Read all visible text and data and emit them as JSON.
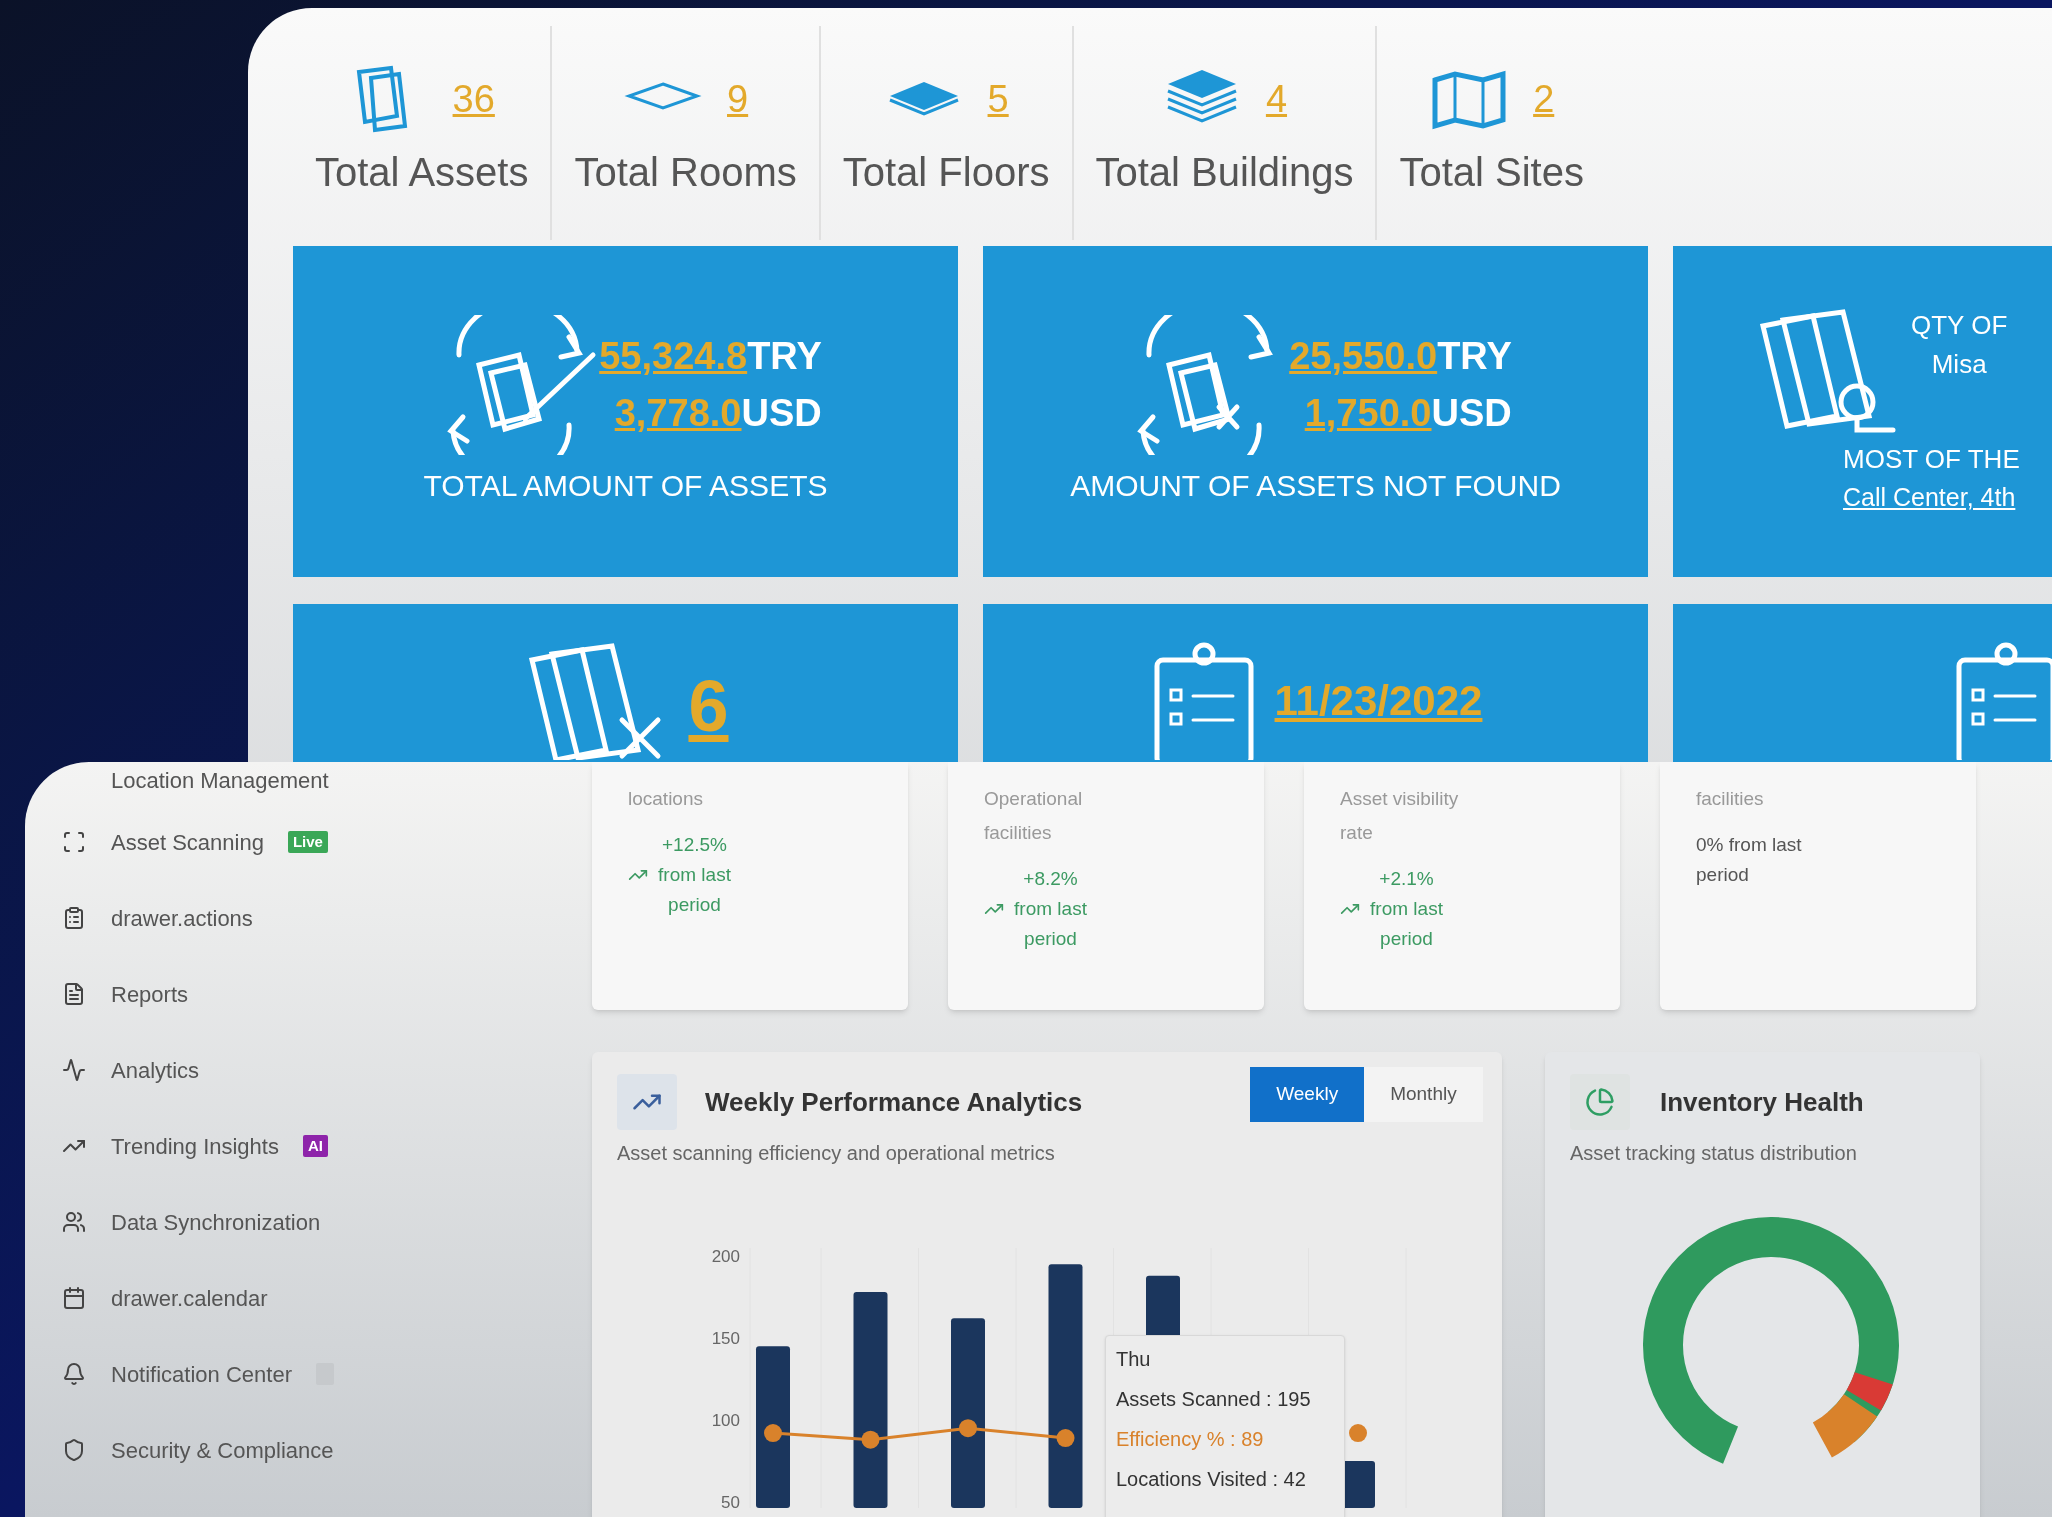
{
  "back_window": {
    "stats": [
      {
        "kind": "assets",
        "value": "36",
        "label": "Total Assets"
      },
      {
        "kind": "rooms",
        "value": "9",
        "label": "Total Rooms"
      },
      {
        "kind": "floors",
        "value": "5",
        "label": "Total Floors"
      },
      {
        "kind": "buildings",
        "value": "4",
        "label": "Total Buildings"
      },
      {
        "kind": "sites",
        "value": "2",
        "label": "Total Sites"
      }
    ],
    "tiles": [
      {
        "kind": "found",
        "amounts": [
          {
            "value": "55,324.8",
            "unit": "TRY"
          },
          {
            "value": "3,778.0",
            "unit": "USD"
          }
        ],
        "caption": "TOTAL AMOUNT OF ASSETS"
      },
      {
        "kind": "not_found",
        "amounts": [
          {
            "value": "25,550.0",
            "unit": "TRY"
          },
          {
            "value": "1,750.0",
            "unit": "USD"
          }
        ],
        "caption": "AMOUNT OF ASSETS NOT FOUND"
      },
      {
        "kind": "misplaced",
        "lines": [
          "QTY OF",
          "Misa"
        ],
        "caption": "MOST OF THE",
        "link": "Call Center, 4th"
      }
    ],
    "tiles_row2": [
      {
        "kind": "missing",
        "value": "6"
      },
      {
        "kind": "clipboard",
        "value": "11/23/2022"
      },
      {
        "kind": "clipboard"
      }
    ]
  },
  "front_window": {
    "sidebar": {
      "items": [
        {
          "label": "Location Management"
        },
        {
          "kind": "scan",
          "label": "Asset Scanning",
          "badge": {
            "text": "Live",
            "color": "#3aa757"
          }
        },
        {
          "kind": "clipboard",
          "label": "drawer.actions"
        },
        {
          "kind": "report",
          "label": "Reports"
        },
        {
          "kind": "activity",
          "label": "Analytics"
        },
        {
          "kind": "trend",
          "label": "Trending Insights",
          "badge": {
            "text": "AI",
            "color": "#8e24aa"
          }
        },
        {
          "kind": "users",
          "label": "Data Synchronization"
        },
        {
          "kind": "calendar",
          "label": "drawer.calendar"
        },
        {
          "kind": "bell",
          "label": "Notification Center",
          "badge": {
            "color": "#c6c9cc"
          }
        },
        {
          "kind": "shield",
          "label": "Security & Compliance"
        }
      ]
    },
    "stat_cards": [
      {
        "description": "locations",
        "change": "+12.5%",
        "note": "from last period",
        "kind": "up"
      },
      {
        "description": "Operational facilities",
        "change": "+8.2%",
        "note": "from last period",
        "kind": "up"
      },
      {
        "description": "Asset visibility rate",
        "change": "+2.1%",
        "note": "from last period",
        "kind": "up"
      },
      {
        "description": "facilities",
        "change": "0%",
        "note": "from last period",
        "kind": "flat"
      }
    ],
    "performance": {
      "title": "Weekly Performance Analytics",
      "subtitle": "Asset scanning efficiency and operational metrics",
      "tabs": [
        {
          "label": "Weekly",
          "selected": true
        },
        {
          "label": "Monthly",
          "selected": false
        }
      ],
      "axis_labels": [
        "200",
        "150",
        "100",
        "50"
      ],
      "tooltip": {
        "title": "Thu",
        "lines": [
          {
            "text": "Assets Scanned : 195",
            "color": "#333333"
          },
          {
            "text": "Efficiency % : 89",
            "color": "#d9822b"
          },
          {
            "text": "Locations Visited : 42",
            "color": "#333333"
          }
        ]
      }
    },
    "inventory": {
      "title": "Inventory Health",
      "subtitle": "Asset tracking status distribution"
    }
  }
}
